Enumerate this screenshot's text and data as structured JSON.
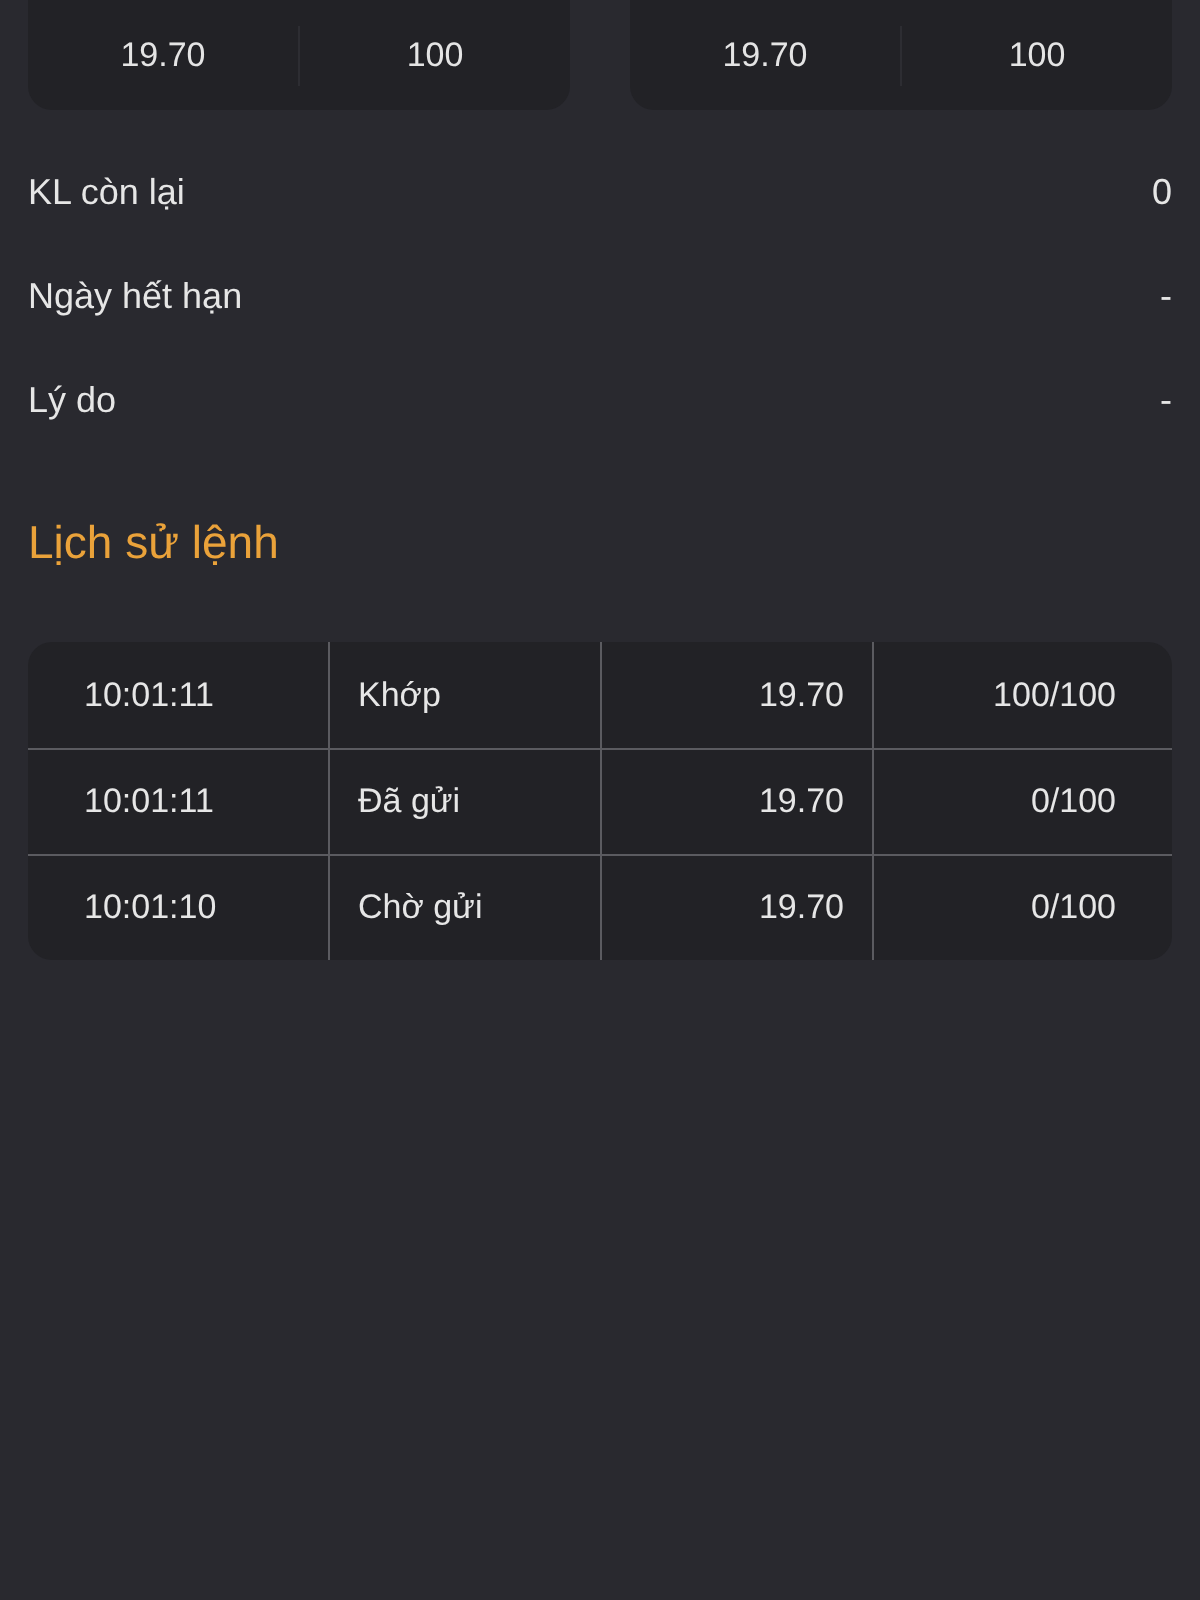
{
  "order_cards": [
    {
      "price": "19.70",
      "quantity": "100"
    },
    {
      "price": "19.70",
      "quantity": "100"
    }
  ],
  "details": [
    {
      "label": "KL còn lại",
      "value": "0"
    },
    {
      "label": "Ngày hết hạn",
      "value": "-"
    },
    {
      "label": "Lý do",
      "value": "-"
    }
  ],
  "history": {
    "title": "Lịch sử lệnh",
    "rows": [
      {
        "time": "10:01:11",
        "status": "Khớp",
        "price": "19.70",
        "matched": "100/100"
      },
      {
        "time": "10:01:11",
        "status": "Đã gửi",
        "price": "19.70",
        "matched": "0/100"
      },
      {
        "time": "10:01:10",
        "status": "Chờ gửi",
        "price": "19.70",
        "matched": "0/100"
      }
    ]
  }
}
